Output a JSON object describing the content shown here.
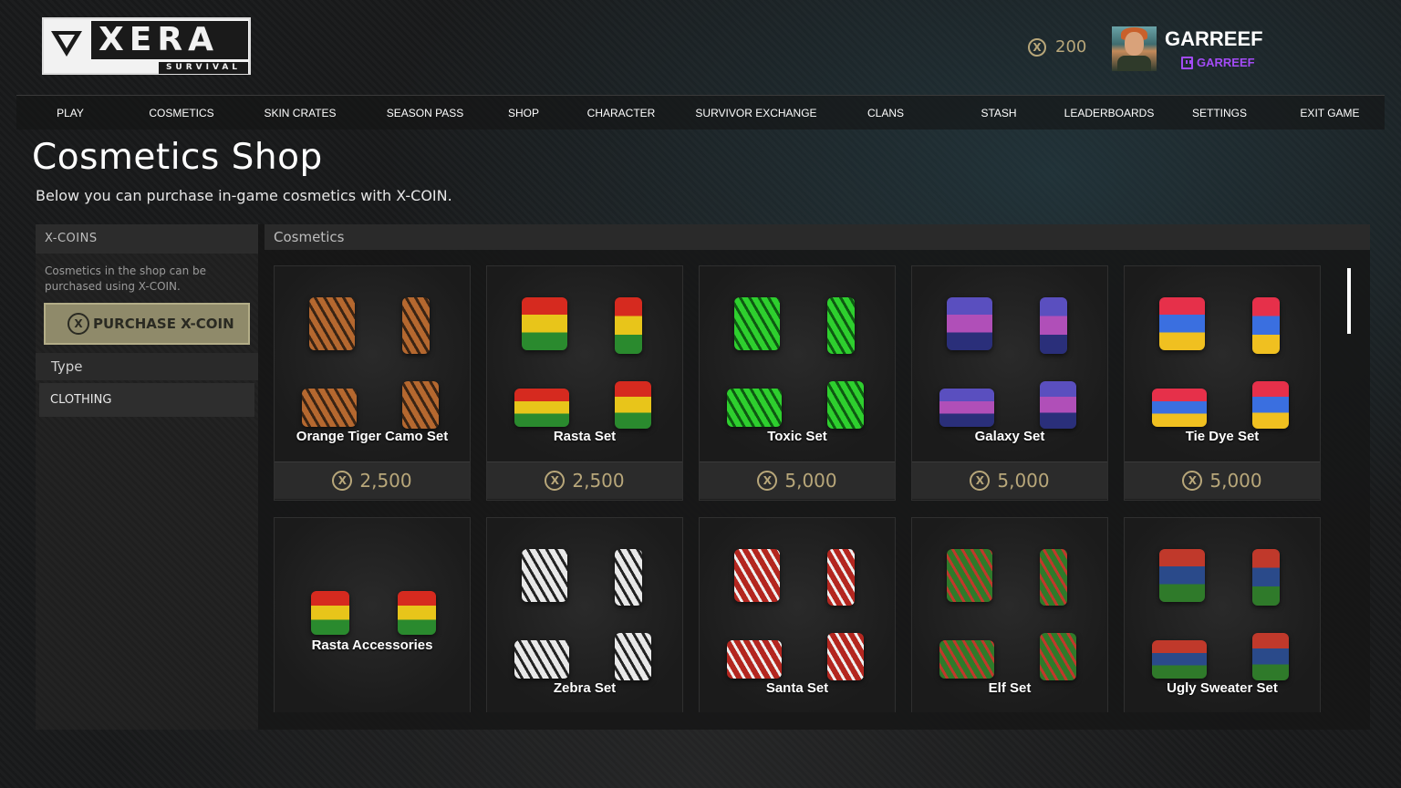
{
  "logo": {
    "word": "XERA",
    "sub": "SURVIVAL"
  },
  "header": {
    "balance": "200",
    "coin_icon": "x-coin-icon",
    "username": "GARREEF",
    "twitch_name": "GARREEF"
  },
  "nav": [
    "PLAY",
    "COSMETICS",
    "SKIN CRATES",
    "SEASON PASS",
    "SHOP",
    "CHARACTER",
    "SURVIVOR EXCHANGE",
    "CLANS",
    "STASH",
    "LEADERBOARDS",
    "SETTINGS",
    "EXIT GAME"
  ],
  "page": {
    "title": "Cosmetics Shop",
    "subtitle": "Below you can purchase in-game cosmetics with X-COIN."
  },
  "sidebar": {
    "header": "X-COINS",
    "note": "Cosmetics in the shop can be purchased using X-COIN.",
    "purchase_label": "PURCHASE X-COIN",
    "type_header": "Type",
    "type_item": "CLOTHING"
  },
  "main": {
    "header": "Cosmetics",
    "items": [
      {
        "name": "Orange Tiger Camo Set",
        "price": "2,500",
        "colors": [
          "#b5682f",
          "#3a2414"
        ]
      },
      {
        "name": "Rasta Set",
        "price": "2,500",
        "colors": [
          "#d62a1f",
          "#e8c51a",
          "#2a8a2e"
        ]
      },
      {
        "name": "Toxic Set",
        "price": "5,000",
        "colors": [
          "#2ecf2e",
          "#0e5a12"
        ]
      },
      {
        "name": "Galaxy Set",
        "price": "5,000",
        "colors": [
          "#5a4fbf",
          "#b04fb8",
          "#2a2f7a"
        ]
      },
      {
        "name": "Tie Dye Set",
        "price": "5,000",
        "colors": [
          "#e6304a",
          "#3a6fe0",
          "#f0c020"
        ]
      },
      {
        "name": "Rasta Accessories",
        "price": "",
        "colors": [
          "#d62a1f",
          "#e8c51a",
          "#2a8a2e"
        ]
      },
      {
        "name": "Zebra Set",
        "price": "",
        "colors": [
          "#e8e8e8",
          "#222222"
        ]
      },
      {
        "name": "Santa Set",
        "price": "",
        "colors": [
          "#b3261f",
          "#f0f0f0"
        ]
      },
      {
        "name": "Elf Set",
        "price": "",
        "colors": [
          "#2f7a2a",
          "#c0392b"
        ]
      },
      {
        "name": "Ugly Sweater Set",
        "price": "",
        "colors": [
          "#c0392b",
          "#2a4a8a",
          "#2f7a2a"
        ]
      }
    ]
  }
}
